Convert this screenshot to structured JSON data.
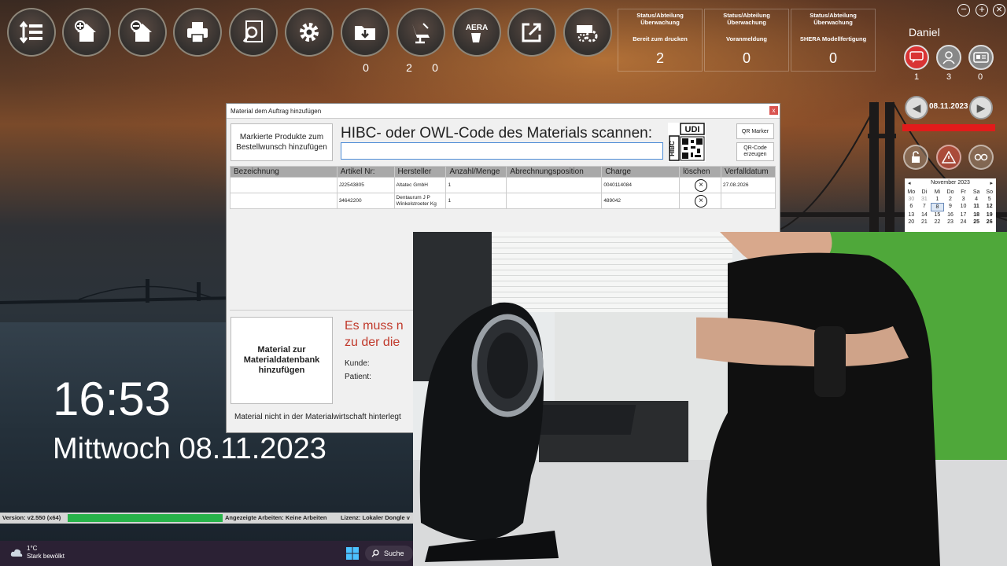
{
  "toolbar": {
    "buttons": [
      {
        "name": "sort-list-icon"
      },
      {
        "name": "add-home-icon"
      },
      {
        "name": "remove-home-icon"
      },
      {
        "name": "printer-icon"
      },
      {
        "name": "document-search-icon"
      },
      {
        "name": "gear-icon"
      },
      {
        "name": "download-folder-icon"
      },
      {
        "name": "dental-chair-icon"
      },
      {
        "name": "aera-icon"
      },
      {
        "name": "external-link-icon"
      },
      {
        "name": "machine-gears-icon"
      }
    ],
    "aera_label": "AERA",
    "counts": [
      "0",
      "2",
      "0"
    ]
  },
  "status_boxes": [
    {
      "header": "Status/Abteilung Überwachung",
      "sub": "Bereit zum drucken",
      "value": "2"
    },
    {
      "header": "Status/Abteilung Überwachung",
      "sub": "Voranmeldung",
      "value": "0"
    },
    {
      "header": "Status/Abteilung Überwachung",
      "sub": "SHERA Modellfertigung",
      "value": "0"
    }
  ],
  "window_controls": {
    "minimize": "−",
    "maximize": "+",
    "close": "×"
  },
  "user": {
    "name": "Daniel",
    "icons": [
      {
        "name": "chat-icon",
        "count": "1",
        "color": "#d93434"
      },
      {
        "name": "person-icon",
        "count": "3",
        "color": "#888888"
      },
      {
        "name": "id-card-icon",
        "count": "0",
        "color": "#888888"
      }
    ]
  },
  "date_nav": {
    "date": "08.11.2023",
    "prev": "◀",
    "next": "▶"
  },
  "calendar": {
    "month": "November 2023",
    "weekdays": [
      "Mo",
      "Di",
      "Mi",
      "Do",
      "Fr",
      "Sa",
      "So"
    ],
    "rows": [
      [
        "30",
        "31",
        "1",
        "2",
        "3",
        "4",
        "5"
      ],
      [
        "6",
        "7",
        "8",
        "9",
        "10",
        "11",
        "12"
      ],
      [
        "13",
        "14",
        "15",
        "16",
        "17",
        "18",
        "19"
      ],
      [
        "20",
        "21",
        "22",
        "23",
        "24",
        "25",
        "26"
      ]
    ]
  },
  "dialog": {
    "title": "Material dem Auftrag hinzufügen",
    "close": "x",
    "add_marked_button": "Markierte Produkte zum Bestellwunsch hinzufügen",
    "scan_label": "HIBC- oder OWL-Code des Materials scannen:",
    "scan_value": "",
    "udi_label": "UDI",
    "hibc_label": "HIBC",
    "qr_marker_button": "QR Marker",
    "qr_code_button": "QR-Code erzeugen",
    "columns": [
      "Bezeichnung",
      "Artikel Nr:",
      "Hersteller",
      "Anzahl/Menge",
      "Abrechnungsposition",
      "Charge",
      "löschen",
      "Verfalldatum"
    ],
    "rows": [
      {
        "bezeichnung": "",
        "artikel": "J22543805",
        "hersteller": "Altatec GmbH",
        "anzahl": "1",
        "abrechnung": "",
        "charge": "0040114084",
        "verfall": "27.08.2026"
      },
      {
        "bezeichnung": "",
        "artikel": "34642200",
        "hersteller": "Dentaurum J P Winkelstroeter Kg",
        "anzahl": "1",
        "abrechnung": "",
        "charge": "489042",
        "verfall": ""
      }
    ],
    "add_material_db_button": "Material zur Materialdatenbank hinzufügen",
    "warning_line1": "Es muss n",
    "warning_line2": "zu der die",
    "kunde_label": "Kunde:",
    "patient_label": "Patient:",
    "footer_note": "Material nicht in der Materialwirtschaft hinterlegt"
  },
  "clock": {
    "time": "16:53",
    "date": "Mittwoch 08.11.2023"
  },
  "version_bar": {
    "version": "Version: v2.550 (x64)",
    "progress": 1.0,
    "jobs": "Angezeigte Arbeiten: Keine Arbeiten",
    "license": "Lizenz:  Lokaler Dongle v"
  },
  "taskbar": {
    "temperature": "1°C",
    "weather": "Stark bewölkt",
    "search": "Suche"
  },
  "colors": {
    "accent_red": "#e21b1b",
    "progress_green": "#28b34a",
    "warning_red": "#c0392b"
  }
}
